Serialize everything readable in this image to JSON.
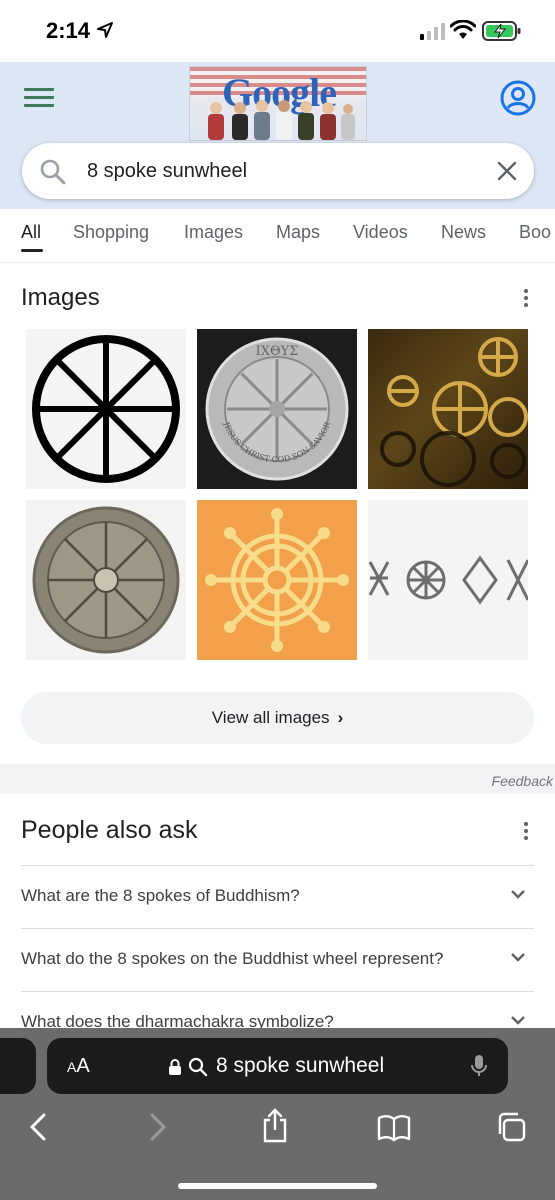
{
  "status_bar": {
    "time": "2:14"
  },
  "header": {
    "doodle_text": "Google"
  },
  "search": {
    "query": "8 spoke sunwheel"
  },
  "tabs": [
    "All",
    "Shopping",
    "Images",
    "Maps",
    "Videos",
    "News",
    "Boo"
  ],
  "images_section": {
    "title": "Images",
    "view_all_label": "View all images",
    "thumbnails": [
      {
        "subject": "black 8-spoke wheel symbol"
      },
      {
        "subject": "silver ichthys wheel coin",
        "coin_top_text": "IXΘYΣ",
        "coin_ring_text": "JESUS CHRIST GOD SON SAVIOR"
      },
      {
        "subject": "golden wheel sculptures"
      },
      {
        "subject": "engraved metal wheel medallion"
      },
      {
        "subject": "dharma wheel on orange background"
      },
      {
        "subject": "hand-drawn wheel symbols"
      }
    ]
  },
  "feedback_label": "Feedback",
  "people_also_ask": {
    "title": "People also ask",
    "questions": [
      "What are the 8 spokes of Buddhism?",
      "What do the 8 spokes on the Buddhist wheel represent?",
      "What does the dharmachakra symbolize?"
    ]
  },
  "safari": {
    "text_size_label_small": "A",
    "text_size_label_large": "A",
    "address": "8 spoke sunwheel"
  },
  "colors": {
    "header_bg": "#dde7f5",
    "accent_blue": "#1a73e8",
    "safari_bar": "#6b6b6b"
  }
}
